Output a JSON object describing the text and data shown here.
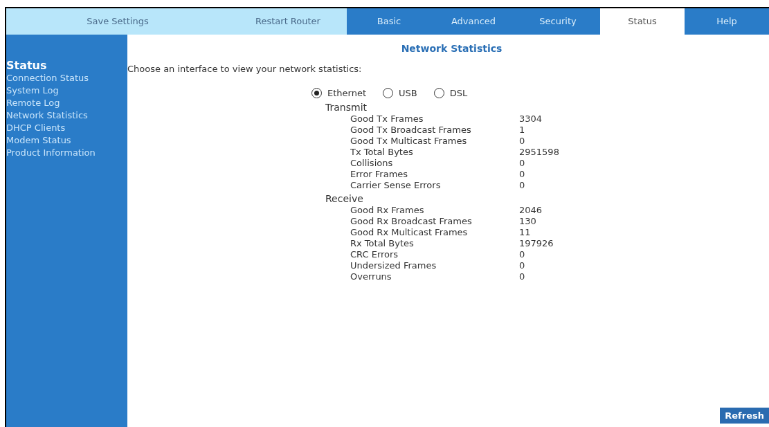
{
  "top_bar": {
    "actions": [
      "Save Settings",
      "Restart Router"
    ],
    "tabs": [
      {
        "label": "Basic",
        "selected": false
      },
      {
        "label": "Advanced",
        "selected": false
      },
      {
        "label": "Security",
        "selected": false
      },
      {
        "label": "Status",
        "selected": true
      },
      {
        "label": "Help",
        "selected": false
      }
    ]
  },
  "sidebar": {
    "title": "Status",
    "items": [
      "Connection Status",
      "System Log",
      "Remote Log",
      "Network Statistics",
      "DHCP Clients",
      "Modem Status",
      "Product Information"
    ]
  },
  "page_title": "Network Statistics",
  "prompt": "Choose an interface to view your network statistics:",
  "interfaces": [
    {
      "label": "Ethernet",
      "selected": true
    },
    {
      "label": "USB",
      "selected": false
    },
    {
      "label": "DSL",
      "selected": false
    }
  ],
  "sections": [
    {
      "title": "Transmit",
      "rows": [
        {
          "label": "Good Tx Frames",
          "value": "3304"
        },
        {
          "label": "Good Tx Broadcast Frames",
          "value": "1"
        },
        {
          "label": "Good Tx Multicast Frames",
          "value": "0"
        },
        {
          "label": "Tx Total Bytes",
          "value": "2951598"
        },
        {
          "label": "Collisions",
          "value": "0"
        },
        {
          "label": "Error Frames",
          "value": "0"
        },
        {
          "label": "Carrier Sense Errors",
          "value": "0"
        }
      ]
    },
    {
      "title": "Receive",
      "rows": [
        {
          "label": "Good Rx Frames",
          "value": "2046"
        },
        {
          "label": "Good Rx Broadcast Frames",
          "value": "130"
        },
        {
          "label": "Good Rx Multicast Frames",
          "value": "11"
        },
        {
          "label": "Rx Total Bytes",
          "value": "197926"
        },
        {
          "label": "CRC Errors",
          "value": "0"
        },
        {
          "label": "Undersized Frames",
          "value": "0"
        },
        {
          "label": "Overruns",
          "value": "0"
        }
      ]
    }
  ],
  "refresh_button": "Refresh"
}
